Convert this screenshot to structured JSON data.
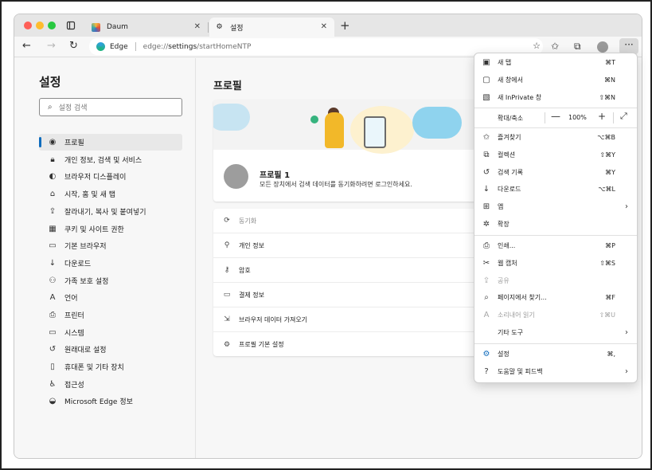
{
  "browser": {
    "tabs": [
      {
        "label": "Daum",
        "active": false
      },
      {
        "label": "설정",
        "active": true
      }
    ],
    "address": {
      "brand": "Edge",
      "url_prefix": "edge://",
      "url_main": "settings",
      "url_suffix": "/startHomeNTP"
    }
  },
  "sidebar": {
    "title": "설정",
    "search_placeholder": "설정 검색",
    "items": [
      {
        "label": "프로필",
        "icon": "profile-icon",
        "active": true
      },
      {
        "label": "개인 정보, 검색 및 서비스",
        "icon": "lock-icon"
      },
      {
        "label": "브라우저 디스플레이",
        "icon": "palette-icon"
      },
      {
        "label": "시작, 홈 및 새 탭",
        "icon": "home-icon"
      },
      {
        "label": "잘라내기, 복사 및 붙여넣기",
        "icon": "share-icon"
      },
      {
        "label": "쿠키 및 사이트 권한",
        "icon": "cookie-icon"
      },
      {
        "label": "기본 브라우저",
        "icon": "browser-icon"
      },
      {
        "label": "다운로드",
        "icon": "download-icon"
      },
      {
        "label": "가족 보호 설정",
        "icon": "family-icon"
      },
      {
        "label": "언어",
        "icon": "language-icon"
      },
      {
        "label": "프린터",
        "icon": "printer-icon"
      },
      {
        "label": "시스템",
        "icon": "system-icon"
      },
      {
        "label": "원래대로 설정",
        "icon": "reset-icon"
      },
      {
        "label": "휴대폰 및 기타 장치",
        "icon": "phone-icon"
      },
      {
        "label": "접근성",
        "icon": "accessibility-icon"
      },
      {
        "label": "Microsoft Edge 정보",
        "icon": "edge-icon"
      }
    ]
  },
  "main": {
    "title": "프로필",
    "profile_name": "프로필 1",
    "profile_desc": "모든 장치에서 검색 데이터를 동기화하려면 로그인하세요.",
    "rows": [
      {
        "label": "동기화",
        "icon": "sync-icon",
        "dim": true
      },
      {
        "label": "개인 정보",
        "icon": "person-icon"
      },
      {
        "label": "암호",
        "icon": "key-icon"
      },
      {
        "label": "결제 정보",
        "icon": "card-icon"
      },
      {
        "label": "브라우저 데이터 가져오기",
        "icon": "import-icon"
      },
      {
        "label": "프로필 기본 설정",
        "icon": "profile-settings-icon"
      }
    ]
  },
  "menu": {
    "items": [
      {
        "label": "새 탭",
        "shortcut": "⌘T",
        "icon": "new-tab-icon"
      },
      {
        "label": "새 창에서",
        "shortcut": "⌘N",
        "icon": "new-window-icon"
      },
      {
        "label": "새 InPrivate 창",
        "shortcut": "⇧⌘N",
        "icon": "inprivate-icon"
      },
      {
        "label": "즐겨찾기",
        "shortcut": "⌥⌘B",
        "icon": "favorites-icon"
      },
      {
        "label": "컬렉션",
        "shortcut": "⇧⌘Y",
        "icon": "collections-icon"
      },
      {
        "label": "검색 기록",
        "shortcut": "⌘Y",
        "icon": "history-icon"
      },
      {
        "label": "다운로드",
        "shortcut": "⌥⌘L",
        "icon": "download-icon"
      },
      {
        "label": "앱",
        "shortcut": "",
        "icon": "apps-icon",
        "submenu": true
      },
      {
        "label": "확장",
        "shortcut": "",
        "icon": "extensions-icon"
      },
      {
        "label": "인쇄...",
        "shortcut": "⌘P",
        "icon": "print-icon"
      },
      {
        "label": "웹 캡처",
        "shortcut": "⇧⌘S",
        "icon": "web-capture-icon"
      },
      {
        "label": "공유",
        "shortcut": "",
        "icon": "share-icon",
        "disabled": true
      },
      {
        "label": "페이지에서 찾기...",
        "shortcut": "⌘F",
        "icon": "find-icon"
      },
      {
        "label": "소리내어 읽기",
        "shortcut": "⇧⌘U",
        "icon": "read-aloud-icon",
        "disabled": true
      },
      {
        "label": "기타 도구",
        "shortcut": "",
        "icon": "",
        "submenu": true
      },
      {
        "label": "설정",
        "shortcut": "⌘,",
        "icon": "settings-icon"
      },
      {
        "label": "도움말 및 피드백",
        "shortcut": "",
        "icon": "help-icon",
        "submenu": true
      }
    ],
    "zoom": {
      "label": "확대/축소",
      "minus": "—",
      "value": "100%",
      "plus": "+"
    }
  }
}
